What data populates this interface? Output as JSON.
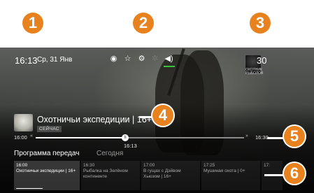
{
  "callouts": [
    "1",
    "2",
    "3",
    "4",
    "5",
    "6"
  ],
  "status": {
    "time": "16:13",
    "date": "Ср, 31 Янв",
    "icons": [
      "record-icon",
      "star-icon",
      "settings-icon",
      "gear-icon",
      "volume-icon"
    ]
  },
  "channel": {
    "number": "30",
    "logo_text": "ОХОТНИК РЫБОЛОВ"
  },
  "program": {
    "title": "Охотничьи экспедиции | 16+",
    "badge": "СЕЙЧАС"
  },
  "timeline": {
    "start": "16:00",
    "end": "16:30",
    "current": "16:13",
    "progress": 0.43,
    "rew_icon": "«",
    "ffw_icon": "»",
    "knob_icon": "II"
  },
  "guide": {
    "tabs": [
      "Программа передач",
      "Сегодня"
    ],
    "cards": [
      {
        "time": "16:00",
        "name": "Охотничьи экспедиции | 16+",
        "active": true,
        "progress": 0.43
      },
      {
        "time": "16:30",
        "name": "Рыбалка на Зелёном континенте",
        "active": false
      },
      {
        "time": "17:00",
        "name": "В гущах с Дэйвом Хьюзом | 16+",
        "active": false
      },
      {
        "time": "17:25",
        "name": "Мушиная охота | 0+",
        "active": false
      },
      {
        "time": "17:",
        "name": "",
        "active": false
      }
    ]
  },
  "colors": {
    "callout": "#e8821e",
    "audio_underline": "#3cc13c"
  }
}
